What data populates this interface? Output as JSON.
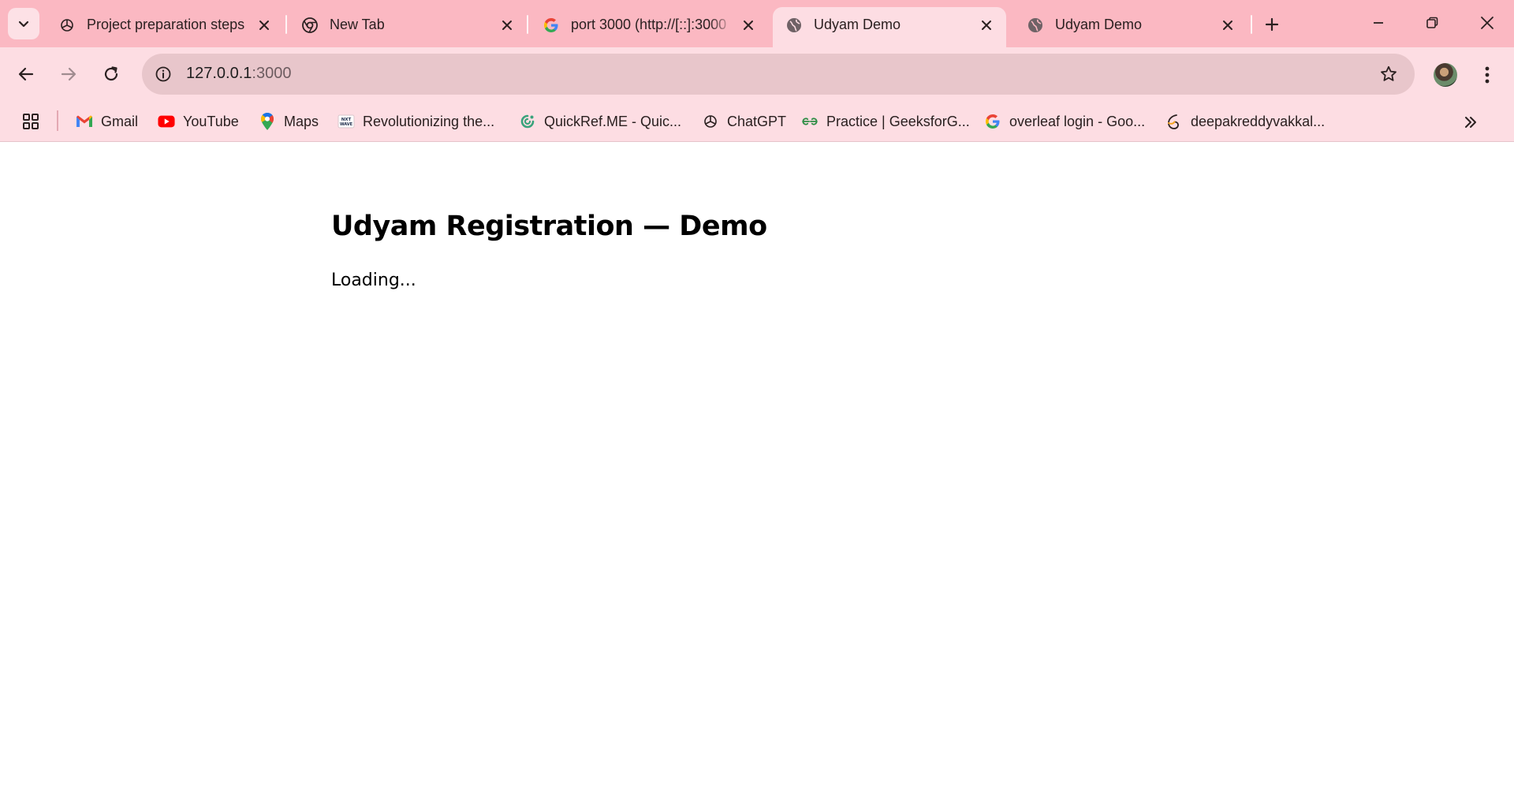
{
  "browser": {
    "tabs": [
      {
        "title": "Project preparation steps",
        "favicon": "chatgpt-icon",
        "active": false
      },
      {
        "title": "New Tab",
        "favicon": "chrome-icon",
        "active": false
      },
      {
        "title": "port 3000 (http://[::]:3000",
        "favicon": "google-icon",
        "active": false
      },
      {
        "title": "Udyam Demo",
        "favicon": "globe-icon",
        "active": true
      },
      {
        "title": "Udyam Demo",
        "favicon": "globe-icon",
        "active": false
      }
    ],
    "address_bar": {
      "host": "127.0.0.1",
      "port": ":3000"
    },
    "bookmarks": [
      {
        "label": "Gmail",
        "icon": "gmail-icon"
      },
      {
        "label": "YouTube",
        "icon": "youtube-icon"
      },
      {
        "label": "Maps",
        "icon": "maps-icon"
      },
      {
        "label": "Revolutionizing the...",
        "icon": "nxtwave-icon"
      },
      {
        "label": "QuickRef.ME - Quic...",
        "icon": "quickref-icon"
      },
      {
        "label": "ChatGPT",
        "icon": "chatgpt-icon"
      },
      {
        "label": "Practice | GeeksforG...",
        "icon": "geeksforgeeks-icon"
      },
      {
        "label": "overleaf login - Goo...",
        "icon": "google-icon"
      },
      {
        "label": "deepakreddyvakkal...",
        "icon": "overleaf-icon"
      }
    ],
    "colors": {
      "tabstrip": "#fbb8c2",
      "toolbar": "#fddde3",
      "omnibox": "#e8c6cb"
    }
  },
  "page": {
    "heading": "Udyam Registration — Demo",
    "status": "Loading..."
  }
}
